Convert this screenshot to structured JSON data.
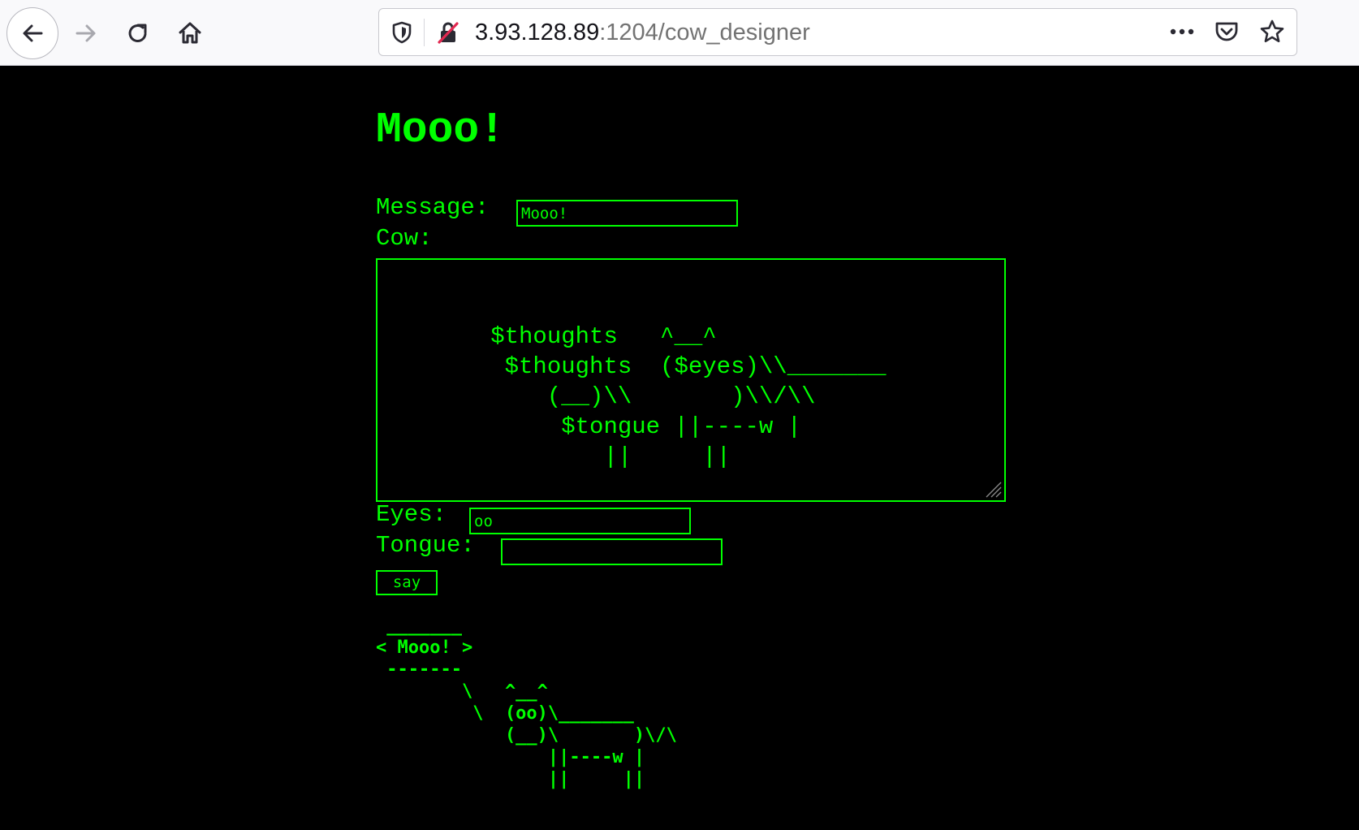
{
  "browser": {
    "url_host": "3.93.128.89",
    "url_path": ":1204/cow_designer",
    "icons": {
      "back": "back-arrow-icon",
      "forward": "forward-arrow-icon",
      "reload": "reload-icon",
      "home": "home-icon",
      "tracking": "shield-icon",
      "insecure": "insecure-lock-icon",
      "more": "more-dots-icon",
      "pocket": "pocket-icon",
      "bookmark": "star-icon"
    }
  },
  "page": {
    "title": "Mooo!",
    "accent_color": "#00ff00",
    "background_color": "#000000",
    "form": {
      "message_label": "Message:",
      "message_value": "Mooo!",
      "cow_label": "Cow:",
      "cow_template": "        $thoughts   ^__^\n         $thoughts  ($eyes)\\\\_______\n            (__)\\\\       )\\\\/\\\\\n             $tongue ||----w |\n                ||     ||",
      "eyes_label": "Eyes:",
      "eyes_value": "oo",
      "tongue_label": "Tongue:",
      "tongue_value": "",
      "submit_label": "say"
    },
    "output": " _______\n< Mooo! >\n -------\n        \\   ^__^\n         \\  (oo)\\_______\n            (__)\\       )\\/\\\n                ||----w |\n                ||     ||"
  }
}
